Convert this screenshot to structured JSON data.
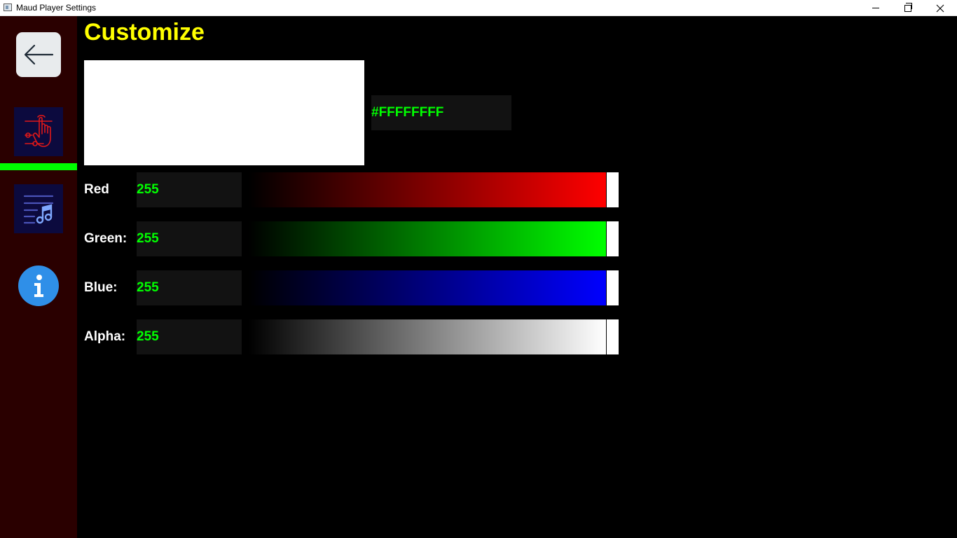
{
  "window": {
    "title": "Maud Player Settings"
  },
  "sidebar": {
    "items": [
      {
        "name": "back",
        "icon": "arrow-left-icon"
      },
      {
        "name": "customize",
        "icon": "touch-settings-icon",
        "active": true
      },
      {
        "name": "playlist",
        "icon": "music-list-icon"
      },
      {
        "name": "info",
        "icon": "info-icon"
      }
    ],
    "active_indicator_color": "#00ff00"
  },
  "page": {
    "title": "Customize",
    "title_color": "#ffff00"
  },
  "color": {
    "hex": "#FFFFFFFF",
    "preview_color": "#ffffff"
  },
  "channels": [
    {
      "label": "Red",
      "value": "255",
      "gradient_end": "#ff0000"
    },
    {
      "label": "Green:",
      "value": "255",
      "gradient_end": "#00ff00"
    },
    {
      "label": "Blue:",
      "value": "255",
      "gradient_end": "#0000ff"
    },
    {
      "label": "Alpha:",
      "value": "255",
      "gradient_end": "#ffffff"
    }
  ]
}
